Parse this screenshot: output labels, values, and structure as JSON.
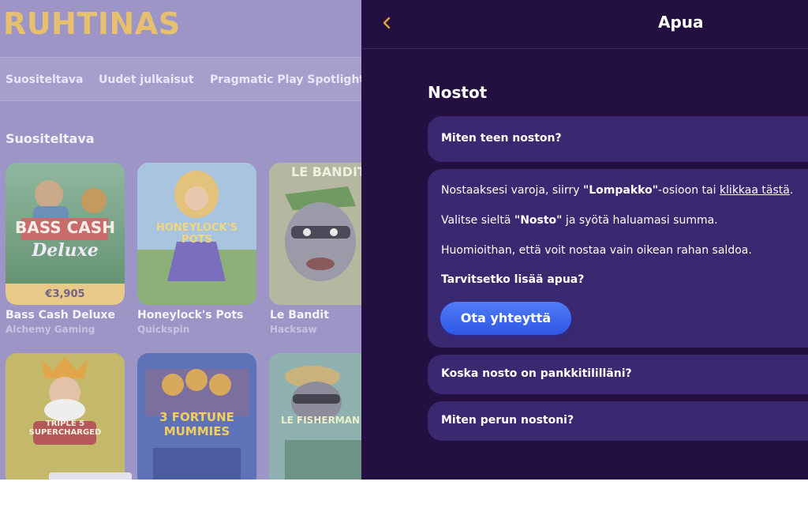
{
  "brand": {
    "name": "RUHTINAS"
  },
  "nav": {
    "items": [
      {
        "label": "Suositeltava"
      },
      {
        "label": "Uudet julkaisut"
      },
      {
        "label": "Pragmatic Play Spotlight"
      }
    ]
  },
  "section": {
    "title": "Suositeltava"
  },
  "games": [
    {
      "name": "Bass Cash Deluxe",
      "provider": "Alchemy Gaming",
      "price": "€3,905",
      "art_text": "BASS CASH",
      "art_sub": "Deluxe"
    },
    {
      "name": "Honeylock's Pots",
      "provider": "Quickspin",
      "art_text": "HONEYLOCK'S POTS"
    },
    {
      "name": "Le Bandit",
      "provider": "Hacksaw",
      "art_text": "LE BANDIT"
    },
    {
      "name": "",
      "provider": "",
      "art_text": "TRIPLE 5 SUPERCHARGED"
    },
    {
      "name": "",
      "provider": "",
      "art_text": "3 FORTUNE MUMMIES"
    },
    {
      "name": "",
      "provider": "",
      "art_text": "LE FISHERMAN"
    }
  ],
  "help": {
    "title": "Apua",
    "back_icon": "chevron-left-icon",
    "category": "Nostot",
    "faq": [
      {
        "question": "Miten teen noston?"
      },
      {
        "question": "Koska nosto on pankkitililläni?"
      },
      {
        "question": "Miten perun nostoni?"
      }
    ],
    "answer": {
      "line1_a": "Nostaaksesi varoja, siirry ",
      "line1_b": "\"Lompakko\"",
      "line1_c": "-osioon tai ",
      "line1_link": "klikkaa tästä",
      "line1_d": ".",
      "line2_a": "Valitse sieltä ",
      "line2_b": "\"Nosto\"",
      "line2_c": " ja syötä haluamasi summa.",
      "line3": "Huomioithan, että voit nostaa vain oikean rahan saldoa.",
      "line4": "Tarvitsetko lisää apua?",
      "contact_button": "Ota yhteyttä"
    }
  },
  "colors": {
    "panel_bg": "#231041",
    "card_bg": "#3a2870",
    "accent": "#e0a53b",
    "button": "#3a66ee"
  }
}
